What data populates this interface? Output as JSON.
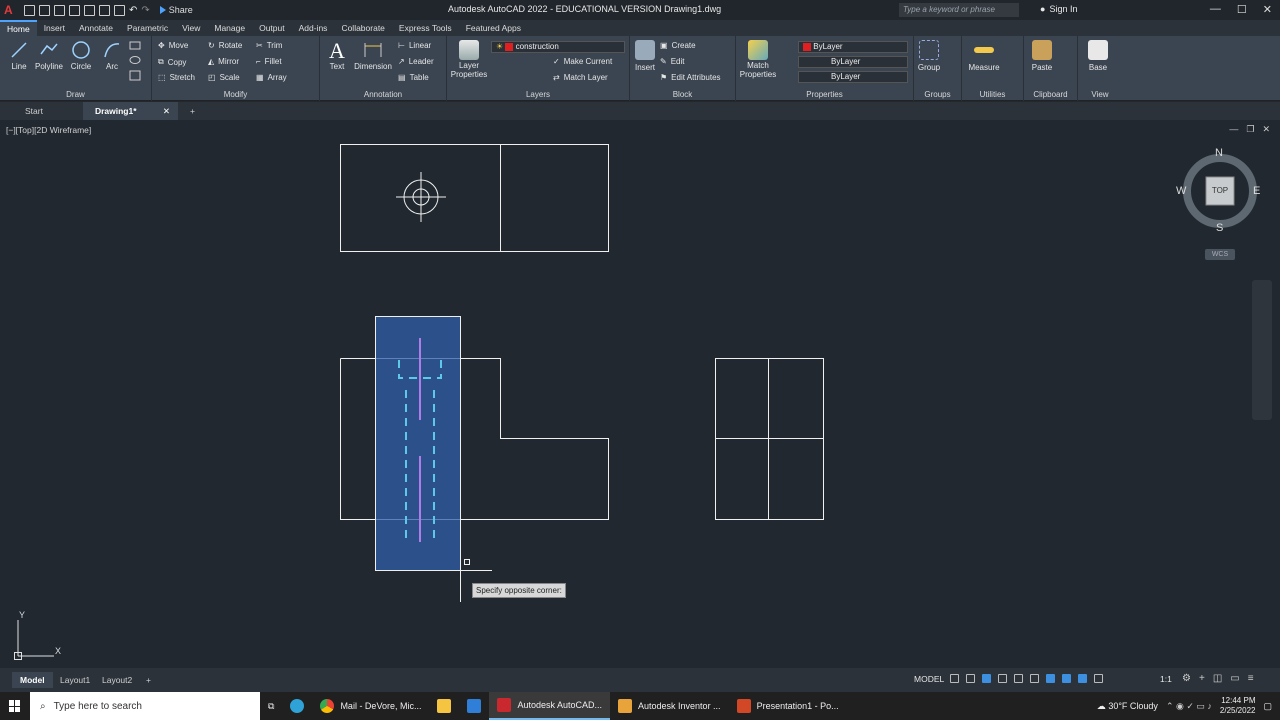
{
  "title": {
    "app_title": "Autodesk AutoCAD 2022 - EDUCATIONAL VERSION   Drawing1.dwg",
    "share_label": "Share",
    "search_placeholder": "Type a keyword or phrase",
    "signin_label": "Sign In"
  },
  "ribbon_tabs": [
    "Home",
    "Insert",
    "Annotate",
    "Parametric",
    "View",
    "Manage",
    "Output",
    "Add-ins",
    "Collaborate",
    "Express Tools",
    "Featured Apps"
  ],
  "ribbon": {
    "draw": {
      "title": "Draw",
      "line": "Line",
      "polyline": "Polyline",
      "circle": "Circle",
      "arc": "Arc"
    },
    "modify": {
      "title": "Modify",
      "move": "Move",
      "rotate": "Rotate",
      "trim": "Trim",
      "copy": "Copy",
      "mirror": "Mirror",
      "fillet": "Fillet",
      "stretch": "Stretch",
      "scale": "Scale",
      "array": "Array"
    },
    "annotation": {
      "title": "Annotation",
      "text": "Text",
      "dimension": "Dimension",
      "linear": "Linear",
      "leader": "Leader",
      "table": "Table"
    },
    "layers": {
      "title": "Layers",
      "layer_properties": "Layer Properties",
      "current_layer": "construction",
      "make_current": "Make Current",
      "match_layer": "Match Layer"
    },
    "block": {
      "title": "Block",
      "insert": "Insert",
      "create": "Create",
      "edit": "Edit",
      "edit_attributes": "Edit Attributes"
    },
    "properties": {
      "title": "Properties",
      "match_properties": "Match Properties",
      "color": "ByLayer",
      "linetype": "ByLayer",
      "lineweight": "ByLayer"
    },
    "groups": {
      "title": "Groups",
      "group": "Group"
    },
    "utilities": {
      "title": "Utilities",
      "measure": "Measure"
    },
    "clipboard": {
      "title": "Clipboard",
      "paste": "Paste"
    },
    "view": {
      "title": "View",
      "base": "Base"
    }
  },
  "doc_tabs": {
    "start": "Start",
    "drawing": "Drawing1*",
    "add": "+"
  },
  "viewport": {
    "controls": "[−][Top][2D Wireframe]",
    "prompt": "Specify opposite corner:",
    "wcs": "WCS"
  },
  "viewcube": {
    "n": "N",
    "s": "S",
    "e": "E",
    "w": "W",
    "face": "TOP"
  },
  "ucs": {
    "x": "X",
    "y": "Y"
  },
  "layout_tabs": [
    "Model",
    "Layout1",
    "Layout2"
  ],
  "status": {
    "model": "MODEL",
    "scale": "1:1"
  },
  "taskbar": {
    "search_placeholder": "Type here to search",
    "apps": [
      "Mail - DeVore, Mic...",
      "Autodesk AutoCAD...",
      "Autodesk Inventor ...",
      "Presentation1 - Po..."
    ],
    "weather": "30°F  Cloudy",
    "time": "12:44 PM",
    "date": "2/25/2022"
  },
  "colors": {
    "accent": "#4ea3ff",
    "selection": "#2f5da8",
    "layer_red": "#e02020"
  }
}
